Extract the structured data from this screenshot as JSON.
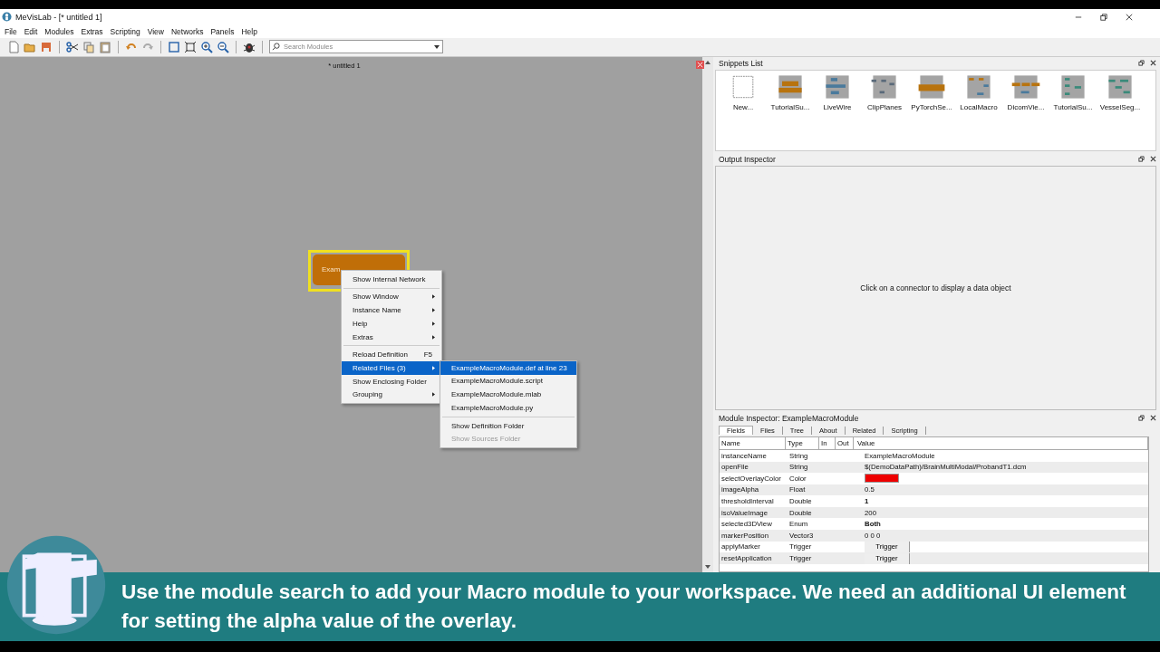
{
  "window": {
    "title": "MeVisLab - [* untitled 1]"
  },
  "menu": [
    "File",
    "Edit",
    "Modules",
    "Extras",
    "Scripting",
    "View",
    "Networks",
    "Panels",
    "Help"
  ],
  "toolbar": {
    "search_placeholder": "Search Modules"
  },
  "canvas": {
    "tab_title": "* untitled 1",
    "module": {
      "label": "Exam",
      "selected": true
    },
    "context_menu": [
      {
        "kind": "item",
        "label": "Show Internal Network",
        "submenu": false,
        "selected": false
      },
      {
        "kind": "separator"
      },
      {
        "kind": "item",
        "label": "Show Window",
        "submenu": true,
        "selected": false
      },
      {
        "kind": "item",
        "label": "Instance Name",
        "submenu": true,
        "selected": false
      },
      {
        "kind": "item",
        "label": "Help",
        "submenu": true,
        "selected": false
      },
      {
        "kind": "item",
        "label": "Extras",
        "submenu": true,
        "selected": false
      },
      {
        "kind": "separator"
      },
      {
        "kind": "item",
        "label": "Reload Definition",
        "shortcut": "F5",
        "submenu": false,
        "selected": false
      },
      {
        "kind": "item",
        "label": "Related Files (3)",
        "submenu": true,
        "selected": true
      },
      {
        "kind": "item",
        "label": "Show Enclosing Folder",
        "submenu": false,
        "selected": false
      },
      {
        "kind": "item",
        "label": "Grouping",
        "submenu": true,
        "selected": false
      }
    ],
    "submenu": [
      {
        "kind": "item",
        "label": "ExampleMacroModule.def at line 23",
        "selected": true,
        "disabled": false
      },
      {
        "kind": "item",
        "label": "ExampleMacroModule.script",
        "selected": false,
        "disabled": false
      },
      {
        "kind": "item",
        "label": "ExampleMacroModule.mlab",
        "selected": false,
        "disabled": false
      },
      {
        "kind": "item",
        "label": "ExampleMacroModule.py",
        "selected": false,
        "disabled": false
      },
      {
        "kind": "separator"
      },
      {
        "kind": "item",
        "label": "Show Definition Folder",
        "selected": false,
        "disabled": false
      },
      {
        "kind": "item",
        "label": "Show Sources Folder",
        "selected": false,
        "disabled": true
      }
    ]
  },
  "snippets": {
    "title": "Snippets List",
    "items": [
      {
        "label": "New...",
        "kind": "blank"
      },
      {
        "label": "TutorialSu...",
        "kind": "network"
      },
      {
        "label": "LiveWire",
        "kind": "network"
      },
      {
        "label": "ClipPlanes",
        "kind": "network"
      },
      {
        "label": "PyTorchSe...",
        "kind": "network"
      },
      {
        "label": "LocalMacro",
        "kind": "network"
      },
      {
        "label": "DicomVie...",
        "kind": "network"
      },
      {
        "label": "TutorialSu...",
        "kind": "network"
      },
      {
        "label": "VesselSeg...",
        "kind": "network"
      }
    ]
  },
  "output_inspector": {
    "title": "Output Inspector",
    "message": "Click on a connector to display a data object"
  },
  "module_inspector": {
    "title": "Module Inspector: ExampleMacroModule",
    "tabs": [
      {
        "label": "Fields",
        "selected": true
      },
      {
        "label": "Files",
        "selected": false
      },
      {
        "label": "Tree",
        "selected": false
      },
      {
        "label": "About",
        "selected": false
      },
      {
        "label": "Related",
        "selected": false
      },
      {
        "label": "Scripting",
        "selected": false
      }
    ],
    "columns": [
      "Name",
      "Type",
      "In",
      "Out",
      "Value"
    ],
    "rows": [
      {
        "name": "instanceName",
        "type": "String",
        "kind": "text",
        "value": "ExampleMacroModule"
      },
      {
        "name": "openFile",
        "type": "String",
        "kind": "text",
        "value": "$(DemoDataPath)/BrainMultiModal/ProbandT1.dcm"
      },
      {
        "name": "selectOverlayColor",
        "type": "Color",
        "kind": "color",
        "color": "#ee0000"
      },
      {
        "name": "imageAlpha",
        "type": "Float",
        "kind": "text",
        "value": "0.5"
      },
      {
        "name": "thresholdInterval",
        "type": "Double",
        "kind": "bold",
        "value": "1"
      },
      {
        "name": "isoValueImage",
        "type": "Double",
        "kind": "text",
        "value": "200"
      },
      {
        "name": "selected3DView",
        "type": "Enum",
        "kind": "bold",
        "value": "Both"
      },
      {
        "name": "markerPosition",
        "type": "Vector3",
        "kind": "text",
        "value": "0 0 0"
      },
      {
        "name": "applyMarker",
        "type": "Trigger",
        "kind": "trigger",
        "value": "Trigger"
      },
      {
        "name": "resetApplication",
        "type": "Trigger",
        "kind": "trigger",
        "value": "Trigger"
      }
    ]
  },
  "caption": "Use the module search to add your Macro module to your workspace. We need an additional UI element for setting the alpha value of the overlay."
}
